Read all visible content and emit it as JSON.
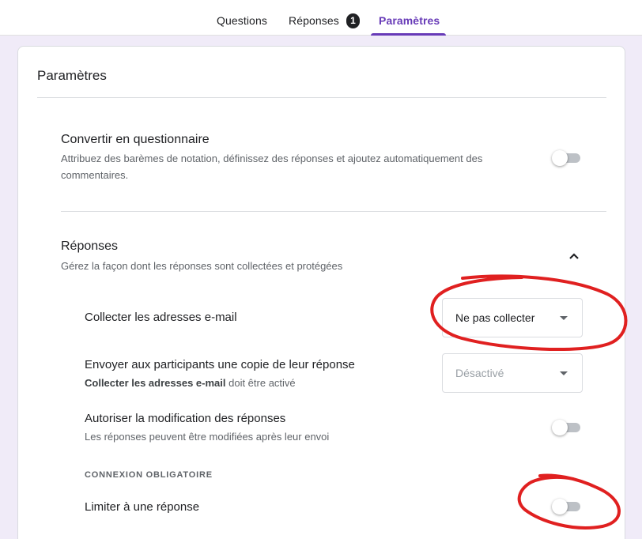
{
  "tabs": {
    "questions": "Questions",
    "responses": "Réponses",
    "responses_badge": "1",
    "settings": "Paramètres"
  },
  "card": {
    "title": "Paramètres"
  },
  "quiz": {
    "title": "Convertir en questionnaire",
    "description": "Attribuez des barèmes de notation, définissez des réponses et ajoutez automatiquement des commentaires.",
    "toggle_on": false
  },
  "responses_section": {
    "title": "Réponses",
    "description": "Gérez la façon dont les réponses sont collectées et protégées",
    "expanded": true
  },
  "collect_emails": {
    "title": "Collecter les adresses e-mail",
    "select_value": "Ne pas collecter"
  },
  "send_copy": {
    "title": "Envoyer aux participants une copie de leur réponse",
    "desc_bold": "Collecter les adresses e-mail",
    "desc_rest": " doit être activé",
    "select_value": "Désactivé",
    "disabled": true
  },
  "allow_edit": {
    "title": "Autoriser la modification des réponses",
    "description": "Les réponses peuvent être modifiées après leur envoi",
    "toggle_on": false
  },
  "login_required": {
    "overline": "CONNEXION OBLIGATOIRE"
  },
  "limit_one": {
    "title": "Limiter à une réponse",
    "toggle_on": false
  },
  "colors": {
    "accent": "#673ab7",
    "background": "#f0ebf8",
    "annotation": "#e02020"
  },
  "icons": {
    "chevron": "chevron-up-icon",
    "dropdown": "dropdown-arrow-icon"
  }
}
